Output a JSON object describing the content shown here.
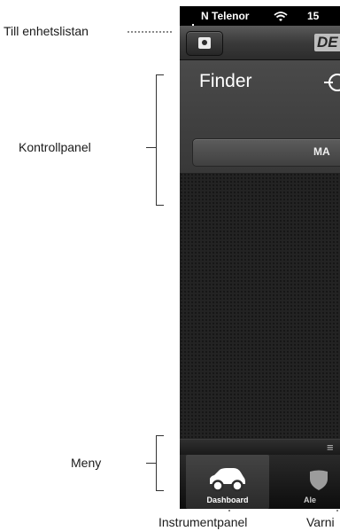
{
  "callouts": {
    "device_list": "Till enhetslistan",
    "control_panel": "Kontrollpanel",
    "menu": "Meny",
    "dashboard": "Instrumentpanel",
    "warnings": "Varni"
  },
  "status_bar": {
    "carrier": "N Telenor",
    "time": "15"
  },
  "nav_bar": {
    "brand": "DE",
    "device_button_icon": "contact-card-icon"
  },
  "control_panel": {
    "title": "Finder",
    "button_label": "MA",
    "icon": "locate-icon"
  },
  "handle_bar": {
    "icon": "menu-lines-icon",
    "glyph": "≡"
  },
  "tab_bar": {
    "tabs": [
      {
        "label": "Dashboard",
        "icon": "car-icon",
        "selected": true
      },
      {
        "label": "Ale",
        "icon": "shield-icon",
        "selected": false
      }
    ]
  },
  "colors": {
    "nav_dark": "#2c2c2c",
    "panel": "#404040",
    "content_bg": "#232323",
    "tab_bar": "#0d0d0d",
    "text_light": "#ffffff"
  }
}
